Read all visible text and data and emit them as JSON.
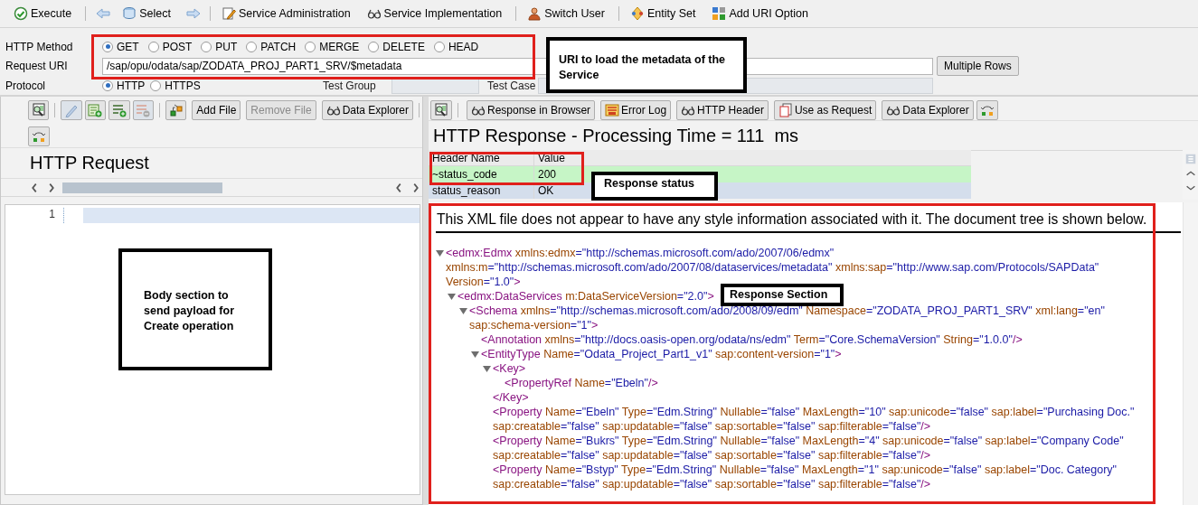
{
  "toolbar": [
    {
      "label": "Execute"
    },
    {
      "label": "Select"
    },
    {
      "label": "Service Administration"
    },
    {
      "label": "Service Implementation"
    },
    {
      "label": "Switch User"
    },
    {
      "label": "Entity Set"
    },
    {
      "label": "Add URI Option"
    }
  ],
  "request_form": {
    "method_label": "HTTP Method",
    "methods": [
      {
        "label": "GET",
        "selected": true
      },
      {
        "label": "POST",
        "selected": false
      },
      {
        "label": "PUT",
        "selected": false
      },
      {
        "label": "PATCH",
        "selected": false
      },
      {
        "label": "MERGE",
        "selected": false
      },
      {
        "label": "DELETE",
        "selected": false
      },
      {
        "label": "HEAD",
        "selected": false
      }
    ],
    "uri_label": "Request URI",
    "uri_value": "/sap/opu/odata/sap/ZODATA_PROJ_PART1_SRV/$metadata",
    "multiple_rows_button": "Multiple Rows",
    "protocol_label": "Protocol",
    "protocols": [
      {
        "label": "HTTP",
        "selected": true
      },
      {
        "label": "HTTPS",
        "selected": false
      }
    ],
    "test_group_label": "Test Group",
    "test_case_label": "Test Case"
  },
  "request_panel": {
    "buttons": [
      {
        "label": "Add File",
        "disabled": false
      },
      {
        "label": "Remove File",
        "disabled": true
      },
      {
        "label": "Data Explorer",
        "disabled": false
      }
    ],
    "title": "HTTP Request",
    "line_numbers": [
      "1"
    ]
  },
  "response_panel": {
    "buttons": [
      {
        "label": "Response in Browser"
      },
      {
        "label": "Error Log"
      },
      {
        "label": "HTTP Header"
      },
      {
        "label": "Use as Request"
      },
      {
        "label": "Data Explorer"
      }
    ],
    "title": "HTTP Response - Processing Time = 111  ms",
    "header_table": {
      "columns": [
        "Header Name",
        "Value"
      ],
      "rows": [
        [
          "~status_code",
          "200"
        ],
        [
          "status_reason",
          "OK"
        ]
      ]
    },
    "notice": "This XML file does not appear to have any style information associated with it. The document tree is shown below.",
    "xml": [
      {
        "open": "<edmx:Edmx",
        "attrs": [
          {
            "name": "xmlns:edmx",
            "value": "=\"http://schemas.microsoft.com/ado/2007/06/edmx\""
          },
          {
            "name": "xmlns:m",
            "value": "=\"http://schemas.microsoft.com/ado/2007/08/dataservices/metadata\""
          },
          {
            "name": "xmlns:sap",
            "value": "=\"http://www.sap.com/Protocols/SAPData\""
          },
          {
            "name": "Version",
            "value": "=\"1.0\""
          }
        ],
        "end": ">",
        "expanded": true,
        "children": [
          {
            "open": "<edmx:DataServices",
            "attrs": [
              {
                "name": "m:DataServiceVersion",
                "value": "=\"2.0\""
              }
            ],
            "end": ">",
            "expanded": true,
            "children": [
              {
                "open": "<Schema",
                "attrs": [
                  {
                    "name": "xmlns",
                    "value": "=\"http://schemas.microsoft.com/ado/2008/09/edm\""
                  },
                  {
                    "name": "Namespace",
                    "value": "=\"ZODATA_PROJ_PART1_SRV\""
                  },
                  {
                    "name": "xml:lang",
                    "value": "=\"en\""
                  },
                  {
                    "name": "sap:schema-version",
                    "value": "=\"1\""
                  }
                ],
                "end": ">",
                "expanded": true,
                "children": [
                  {
                    "open": "<Annotation",
                    "attrs": [
                      {
                        "name": "xmlns",
                        "value": "=\"http://docs.oasis-open.org/odata/ns/edm\""
                      },
                      {
                        "name": "Term",
                        "value": "=\"Core.SchemaVersion\""
                      },
                      {
                        "name": "String",
                        "value": "=\"1.0.0\""
                      }
                    ],
                    "end": "/>"
                  },
                  {
                    "open": "<EntityType",
                    "attrs": [
                      {
                        "name": "Name",
                        "value": "=\"Odata_Project_Part1_v1\""
                      },
                      {
                        "name": "sap:content-version",
                        "value": "=\"1\""
                      }
                    ],
                    "end": ">",
                    "expanded": true,
                    "children": [
                      {
                        "open": "<Key",
                        "end": ">",
                        "expanded": true,
                        "close": "</Key>",
                        "children": [
                          {
                            "open": "<PropertyRef",
                            "attrs": [
                              {
                                "name": "Name",
                                "value": "=\"Ebeln\""
                              }
                            ],
                            "end": "/>"
                          }
                        ]
                      },
                      {
                        "open": "<Property",
                        "attrs": [
                          {
                            "name": "Name",
                            "value": "=\"Ebeln\""
                          },
                          {
                            "name": "Type",
                            "value": "=\"Edm.String\""
                          },
                          {
                            "name": "Nullable",
                            "value": "=\"false\""
                          },
                          {
                            "name": "MaxLength",
                            "value": "=\"10\""
                          },
                          {
                            "name": "sap:unicode",
                            "value": "=\"false\""
                          },
                          {
                            "name": "sap:label",
                            "value": "=\"Purchasing Doc.\""
                          },
                          {
                            "name": "sap:creatable",
                            "value": "=\"false\""
                          },
                          {
                            "name": "sap:updatable",
                            "value": "=\"false\""
                          },
                          {
                            "name": "sap:sortable",
                            "value": "=\"false\""
                          },
                          {
                            "name": "sap:filterable",
                            "value": "=\"false\""
                          }
                        ],
                        "end": "/>"
                      },
                      {
                        "open": "<Property",
                        "attrs": [
                          {
                            "name": "Name",
                            "value": "=\"Bukrs\""
                          },
                          {
                            "name": "Type",
                            "value": "=\"Edm.String\""
                          },
                          {
                            "name": "Nullable",
                            "value": "=\"false\""
                          },
                          {
                            "name": "MaxLength",
                            "value": "=\"4\""
                          },
                          {
                            "name": "sap:unicode",
                            "value": "=\"false\""
                          },
                          {
                            "name": "sap:label",
                            "value": "=\"Company Code\""
                          },
                          {
                            "name": "sap:creatable",
                            "value": "=\"false\""
                          },
                          {
                            "name": "sap:updatable",
                            "value": "=\"false\""
                          },
                          {
                            "name": "sap:sortable",
                            "value": "=\"false\""
                          },
                          {
                            "name": "sap:filterable",
                            "value": "=\"false\""
                          }
                        ],
                        "end": "/>"
                      },
                      {
                        "open": "<Property",
                        "attrs": [
                          {
                            "name": "Name",
                            "value": "=\"Bstyp\""
                          },
                          {
                            "name": "Type",
                            "value": "=\"Edm.String\""
                          },
                          {
                            "name": "Nullable",
                            "value": "=\"false\""
                          },
                          {
                            "name": "MaxLength",
                            "value": "=\"1\""
                          },
                          {
                            "name": "sap:unicode",
                            "value": "=\"false\""
                          },
                          {
                            "name": "sap:label",
                            "value": "=\"Doc. Category\""
                          },
                          {
                            "name": "sap:creatable",
                            "value": "=\"false\""
                          },
                          {
                            "name": "sap:updatable",
                            "value": "=\"false\""
                          },
                          {
                            "name": "sap:sortable",
                            "value": "=\"false\""
                          },
                          {
                            "name": "sap:filterable",
                            "value": "=\"false\""
                          }
                        ],
                        "end": "/>"
                      }
                    ]
                  }
                ]
              }
            ]
          }
        ]
      }
    ]
  },
  "annotations": [
    {
      "text": "URI to load the metadata of the Service"
    },
    {
      "text": "Response status"
    },
    {
      "text": "Body section to send payload for Create operation"
    },
    {
      "text": "Response Section"
    }
  ]
}
